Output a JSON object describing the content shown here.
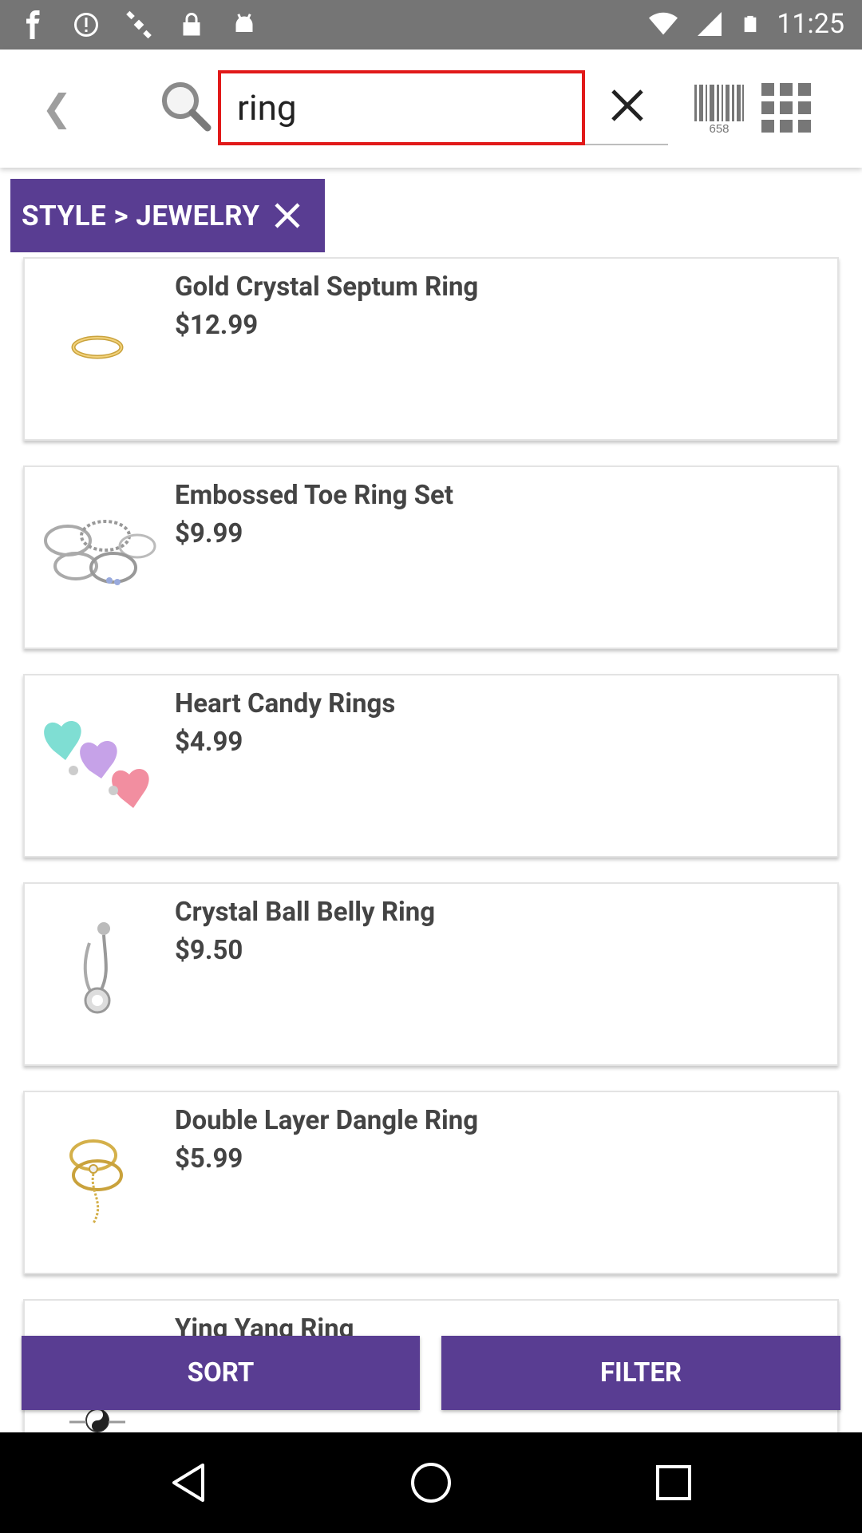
{
  "status_bar": {
    "time": "11:25",
    "icons": [
      "facebook-icon",
      "blocked-icon",
      "satellite-icon",
      "lock-icon",
      "android-icon",
      "wifi-icon",
      "signal-icon",
      "battery-icon"
    ]
  },
  "header": {
    "back_icon": "chevron-left-icon",
    "search_icon": "search-icon",
    "search_value": "ring",
    "clear_icon": "close-icon",
    "barcode_label": "658",
    "grid_icon": "grid-icon"
  },
  "filter_chip": {
    "label": "STYLE > JEWELRY",
    "remove_icon": "close-icon"
  },
  "products": [
    {
      "name": "Gold Crystal Septum Ring",
      "price": "$12.99",
      "thumb": "gold-ring"
    },
    {
      "name": "Embossed Toe Ring Set",
      "price": "$9.99",
      "thumb": "toe-ring-set"
    },
    {
      "name": "Heart Candy Rings",
      "price": "$4.99",
      "thumb": "heart-candy"
    },
    {
      "name": "Crystal Ball Belly Ring",
      "price": "$9.50",
      "thumb": "belly-ring"
    },
    {
      "name": "Double Layer Dangle Ring",
      "price": "$5.99",
      "thumb": "dangle-ring"
    },
    {
      "name": "Ying Yang Ring",
      "price": "",
      "thumb": "yin-yang"
    }
  ],
  "actions": {
    "sort_label": "SORT",
    "filter_label": "FILTER"
  },
  "colors": {
    "accent": "#593d92",
    "search_border": "#e11919",
    "status_bar": "#757575"
  },
  "nav_bar": {
    "buttons": [
      "back-triangle-icon",
      "home-circle-icon",
      "recents-square-icon"
    ]
  }
}
